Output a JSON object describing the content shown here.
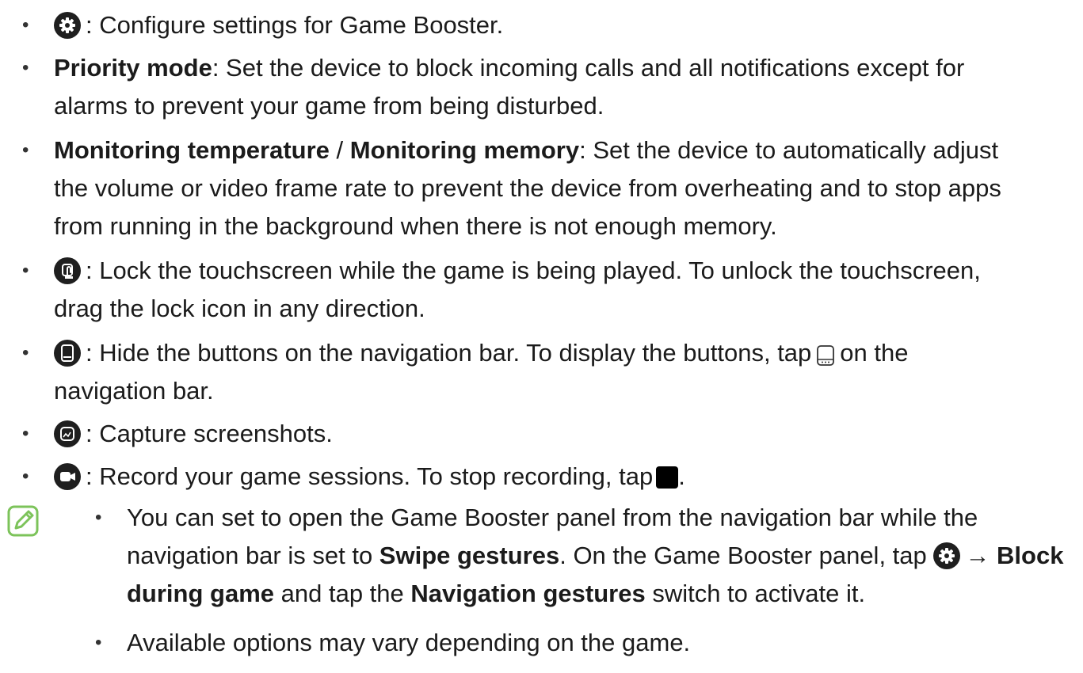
{
  "colors": {
    "text": "#1b1b1b",
    "icon_bg": "#1f1f1f",
    "note_accent": "#7cc35a"
  },
  "items": [
    {
      "icon": "gear-icon",
      "text": ": Configure settings for Game Booster."
    },
    {
      "bold1": "Priority mode",
      "line1": ": Set the device to block incoming calls and all notifications except for",
      "line2": "alarms to prevent your game from being disturbed."
    },
    {
      "bold1": "Monitoring temperature",
      "sep": " / ",
      "bold2": "Monitoring memory",
      "line1": ": Set the device to automatically adjust",
      "line2": "the volume or video frame rate to prevent the device from overheating and to stop apps",
      "line3": "from running in the background when there is not enough memory."
    },
    {
      "icon": "touch-lock-icon",
      "line1": ": Lock the touchscreen while the game is being played. To unlock the touchscreen,",
      "line2": "drag the lock icon in any direction."
    },
    {
      "icon": "navigation-bar-icon",
      "line1a": ": Hide the buttons on the navigation bar. To display the buttons, tap",
      "line1b": "on the",
      "line2": "navigation bar."
    },
    {
      "icon": "screenshot-icon",
      "text": ": Capture screenshots."
    },
    {
      "icon": "record-icon",
      "text": ": Record your game sessions. To stop recording, tap",
      "text_end": "."
    }
  ],
  "notes": [
    {
      "line1": "You can set to open the Game Booster panel from the navigation bar while the",
      "line2a": "navigation bar is set to ",
      "line2b": "Swipe gestures",
      "line2c": ". On the Game Booster panel, tap",
      "line2d": "→",
      "line2e": "Block",
      "line3a": "during game",
      "line3b": " and tap the ",
      "line3c": "Navigation gestures",
      "line3d": " switch to activate it."
    },
    {
      "text": "Available options may vary depending on the game."
    }
  ]
}
